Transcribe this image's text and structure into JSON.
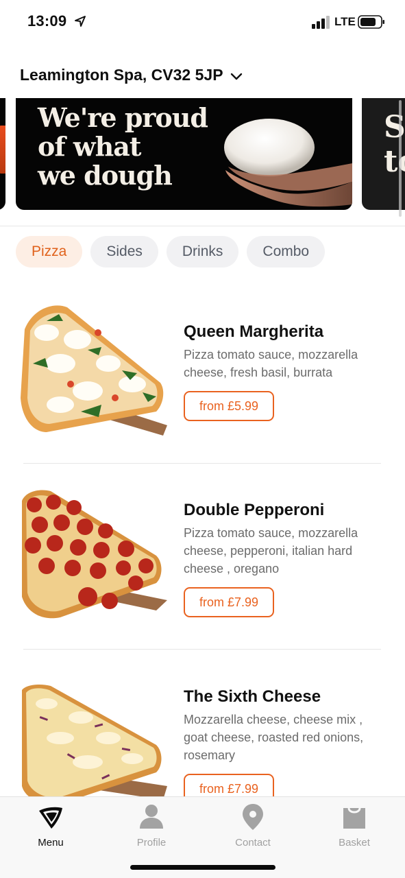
{
  "status": {
    "time": "13:09",
    "network": "LTE"
  },
  "location": {
    "label": "Leamington Spa, CV32 5JP"
  },
  "banners": {
    "main_text": "We're proud\nof what\nwe dough",
    "next_text": "Sa\nto"
  },
  "tabs": [
    {
      "label": "Pizza",
      "active": true
    },
    {
      "label": "Sides",
      "active": false
    },
    {
      "label": "Drinks",
      "active": false
    },
    {
      "label": "Combo",
      "active": false
    }
  ],
  "menu": [
    {
      "name": "Queen Margherita",
      "description": "Pizza tomato sauce, mozzarella cheese, fresh basil, burrata",
      "price": "from £5.99",
      "image": "margherita-pizza-image"
    },
    {
      "name": "Double Pepperoni",
      "description": "Pizza tomato sauce, mozzarella cheese, pepperoni, italian hard cheese , oregano",
      "price": "from £7.99",
      "image": "pepperoni-pizza-image"
    },
    {
      "name": "The Sixth Cheese",
      "description": "Mozzarella cheese, cheese mix , goat cheese, roasted red onions, rosemary",
      "price": "from £7.99",
      "image": "cheese-pizza-image"
    }
  ],
  "nav": [
    {
      "label": "Menu",
      "icon": "pizza-slice-icon",
      "active": true
    },
    {
      "label": "Profile",
      "icon": "profile-icon",
      "active": false
    },
    {
      "label": "Contact",
      "icon": "location-pin-icon",
      "active": false
    },
    {
      "label": "Basket",
      "icon": "basket-icon",
      "active": false
    }
  ],
  "colors": {
    "accent": "#e9621f",
    "active_tab_bg": "#fdeee4",
    "tab_bg": "#f1f1f3"
  }
}
